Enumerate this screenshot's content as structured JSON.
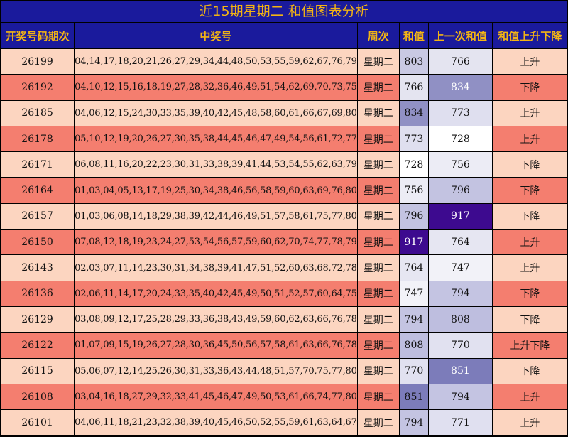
{
  "title": "近15期星期二 和值图表分析",
  "headers": [
    "开奖号码期次",
    "中奖号",
    "周次",
    "和值",
    "上一次和值",
    "和值上升下降"
  ],
  "rows": [
    {
      "period": "26199",
      "numbers": "04,14,17,18,20,21,26,27,29,34,44,48,50,53,55,59,62,67,76,79",
      "weekday": "星期二",
      "sum": "803",
      "prev_sum": "766",
      "trend": "上升",
      "sum_color": "#c9c9e3",
      "prev_color": "#e4e4f0"
    },
    {
      "period": "26192",
      "numbers": "04,10,12,15,16,18,19,27,28,32,36,46,49,51,54,62,69,70,73,75",
      "weekday": "星期二",
      "sum": "766",
      "prev_sum": "834",
      "trend": "下降",
      "sum_color": "#e4e4f0",
      "prev_color": "#9090c4"
    },
    {
      "period": "26185",
      "numbers": "04,06,12,15,24,30,33,35,39,40,42,45,48,58,60,61,66,67,69,80",
      "weekday": "星期二",
      "sum": "834",
      "prev_sum": "773",
      "trend": "上升",
      "sum_color": "#9090c4",
      "prev_color": "#dfdfef"
    },
    {
      "period": "26178",
      "numbers": "05,10,12,19,20,26,27,30,35,38,44,45,46,47,49,54,56,61,72,77",
      "weekday": "星期二",
      "sum": "773",
      "prev_sum": "728",
      "trend": "上升",
      "sum_color": "#dfdfef",
      "prev_color": "#ffffff"
    },
    {
      "period": "26171",
      "numbers": "06,08,11,16,20,22,23,30,31,33,38,39,41,44,53,54,55,62,63,79",
      "weekday": "星期二",
      "sum": "728",
      "prev_sum": "756",
      "trend": "下降",
      "sum_color": "#ffffff",
      "prev_color": "#ececf5"
    },
    {
      "period": "26164",
      "numbers": "01,03,04,05,13,17,19,25,30,34,38,46,56,58,59,60,63,69,76,80",
      "weekday": "星期二",
      "sum": "756",
      "prev_sum": "796",
      "trend": "下降",
      "sum_color": "#ececf5",
      "prev_color": "#c3c3e1"
    },
    {
      "period": "26157",
      "numbers": "01,03,06,08,14,18,29,38,39,42,44,46,49,51,57,58,61,75,77,80",
      "weekday": "星期二",
      "sum": "796",
      "prev_sum": "917",
      "trend": "下降",
      "sum_color": "#c3c3e1",
      "prev_color": "#3d0a8f"
    },
    {
      "period": "26150",
      "numbers": "07,08,12,18,19,23,24,27,53,54,56,57,59,60,62,70,74,77,78,79",
      "weekday": "星期二",
      "sum": "917",
      "prev_sum": "764",
      "trend": "上升",
      "sum_color": "#3d0a8f",
      "prev_color": "#e6e6f2"
    },
    {
      "period": "26143",
      "numbers": "02,03,07,11,14,23,30,31,34,38,39,41,47,51,52,60,63,68,72,78",
      "weekday": "星期二",
      "sum": "764",
      "prev_sum": "747",
      "trend": "上升",
      "sum_color": "#e6e6f2",
      "prev_color": "#f2f2f8"
    },
    {
      "period": "26136",
      "numbers": "02,06,11,14,17,20,24,33,35,40,42,45,49,50,51,52,57,60,64,75",
      "weekday": "星期二",
      "sum": "747",
      "prev_sum": "794",
      "trend": "下降",
      "sum_color": "#f2f2f8",
      "prev_color": "#c4c4e2"
    },
    {
      "period": "26129",
      "numbers": "03,08,09,12,17,25,28,29,33,36,38,43,49,59,60,62,63,66,76,78",
      "weekday": "星期二",
      "sum": "794",
      "prev_sum": "808",
      "trend": "下降",
      "sum_color": "#c4c4e2",
      "prev_color": "#bebedf"
    },
    {
      "period": "26122",
      "numbers": "01,07,09,15,19,26,27,28,30,36,45,50,56,57,58,61,63,66,76,78",
      "weekday": "星期二",
      "sum": "808",
      "prev_sum": "770",
      "trend": "上升下降",
      "sum_color": "#bebedf",
      "prev_color": "#e1e1f0"
    },
    {
      "period": "26115",
      "numbers": "05,06,07,12,14,25,26,30,31,33,36,43,44,48,51,57,70,75,77,80",
      "weekday": "星期二",
      "sum": "770",
      "prev_sum": "851",
      "trend": "下降",
      "sum_color": "#e1e1f0",
      "prev_color": "#7c7cba"
    },
    {
      "period": "26108",
      "numbers": "03,04,16,18,27,29,32,33,41,45,46,47,49,50,53,61,66,74,77,80",
      "weekday": "星期二",
      "sum": "851",
      "prev_sum": "794",
      "trend": "上升",
      "sum_color": "#7c7cba",
      "prev_color": "#c4c4e2"
    },
    {
      "period": "26101",
      "numbers": "04,06,11,18,21,23,32,38,39,40,45,46,50,52,55,59,61,63,64,67",
      "weekday": "星期二",
      "sum": "794",
      "prev_sum": "771",
      "trend": "上升",
      "sum_color": "#c4c4e2",
      "prev_color": "#e0e0f0"
    }
  ]
}
